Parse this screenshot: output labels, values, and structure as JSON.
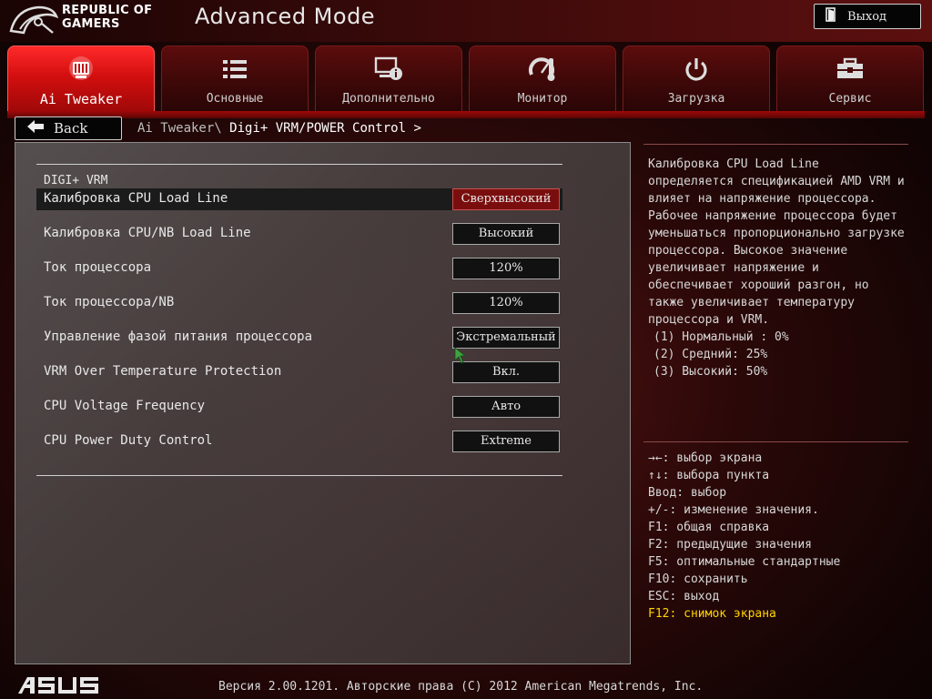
{
  "header": {
    "brand_line1": "REPUBLIC OF",
    "brand_line2": "GAMERS",
    "mode_title": "Advanced Mode",
    "exit_label": "Выход"
  },
  "tabs": [
    {
      "label": "Ai Tweaker",
      "icon": "ai-tweaker-icon",
      "active": true
    },
    {
      "label": "Основные",
      "icon": "list-icon",
      "active": false
    },
    {
      "label": "Дополнительно",
      "icon": "advanced-info-icon",
      "active": false
    },
    {
      "label": "Монитор",
      "icon": "monitor-gauge-icon",
      "active": false
    },
    {
      "label": "Загрузка",
      "icon": "power-icon",
      "active": false
    },
    {
      "label": "Сервис",
      "icon": "toolbox-icon",
      "active": false
    }
  ],
  "nav": {
    "back_label": "Back",
    "breadcrumb_parent": "Ai Tweaker\\",
    "breadcrumb_current": "Digi+ VRM/POWER Control >"
  },
  "section_title": "DIGI+ VRM",
  "settings": [
    {
      "label": "Калибровка CPU Load Line",
      "value": "Сверхвысокий",
      "selected": true
    },
    {
      "label": "Калибровка CPU/NB Load Line",
      "value": "Высокий",
      "selected": false
    },
    {
      "label": "Ток процессора",
      "value": "120%",
      "selected": false
    },
    {
      "label": "Ток процессора/NB",
      "value": "120%",
      "selected": false
    },
    {
      "label": "Управление фазой питания процессора",
      "value": "Экстремальный",
      "selected": false
    },
    {
      "label": "VRM Over Temperature Protection",
      "value": "Вкл.",
      "selected": false
    },
    {
      "label": "CPU Voltage Frequency",
      "value": "Авто",
      "selected": false
    },
    {
      "label": "CPU Power Duty Control",
      "value": "Extreme",
      "selected": false
    }
  ],
  "help": {
    "lines": [
      "Калибровка CPU Load Line",
      "определяется спецификацией AMD VRM и",
      "влияет на напряжение процессора.",
      "Рабочее напряжение процессора будет",
      "уменьшаться пропорционально загрузке",
      "процессора. Высокое значение",
      "увеличивает напряжение и",
      "обеспечивает хороший разгон, но",
      "также увеличивает температуру",
      "процессора и VRM."
    ],
    "items": [
      "(1) Нормальный : 0%",
      "(2) Средний: 25%",
      "(3) Высокий: 50%"
    ]
  },
  "hotkeys": [
    {
      "text": "→←: выбор экрана",
      "highlight": false
    },
    {
      "text": "↑↓: выбора пункта",
      "highlight": false
    },
    {
      "text": "Ввод: выбор",
      "highlight": false
    },
    {
      "text": "+/-: изменение значения.",
      "highlight": false
    },
    {
      "text": "F1: общая справка",
      "highlight": false
    },
    {
      "text": "F2: предыдущие значения",
      "highlight": false
    },
    {
      "text": "F5: оптимальные стандартные",
      "highlight": false
    },
    {
      "text": "F10: сохранить",
      "highlight": false
    },
    {
      "text": "ESC: выход",
      "highlight": false
    },
    {
      "text": "F12: снимок экрана",
      "highlight": true
    }
  ],
  "footer": {
    "version_text": "Версия 2.00.1201. Авторские права (C) 2012 American Megatrends, Inc."
  },
  "colors": {
    "accent_red": "#d40f0f",
    "selected_value_bg": "#7a0e0e",
    "hotkey_highlight": "#ffd400"
  }
}
